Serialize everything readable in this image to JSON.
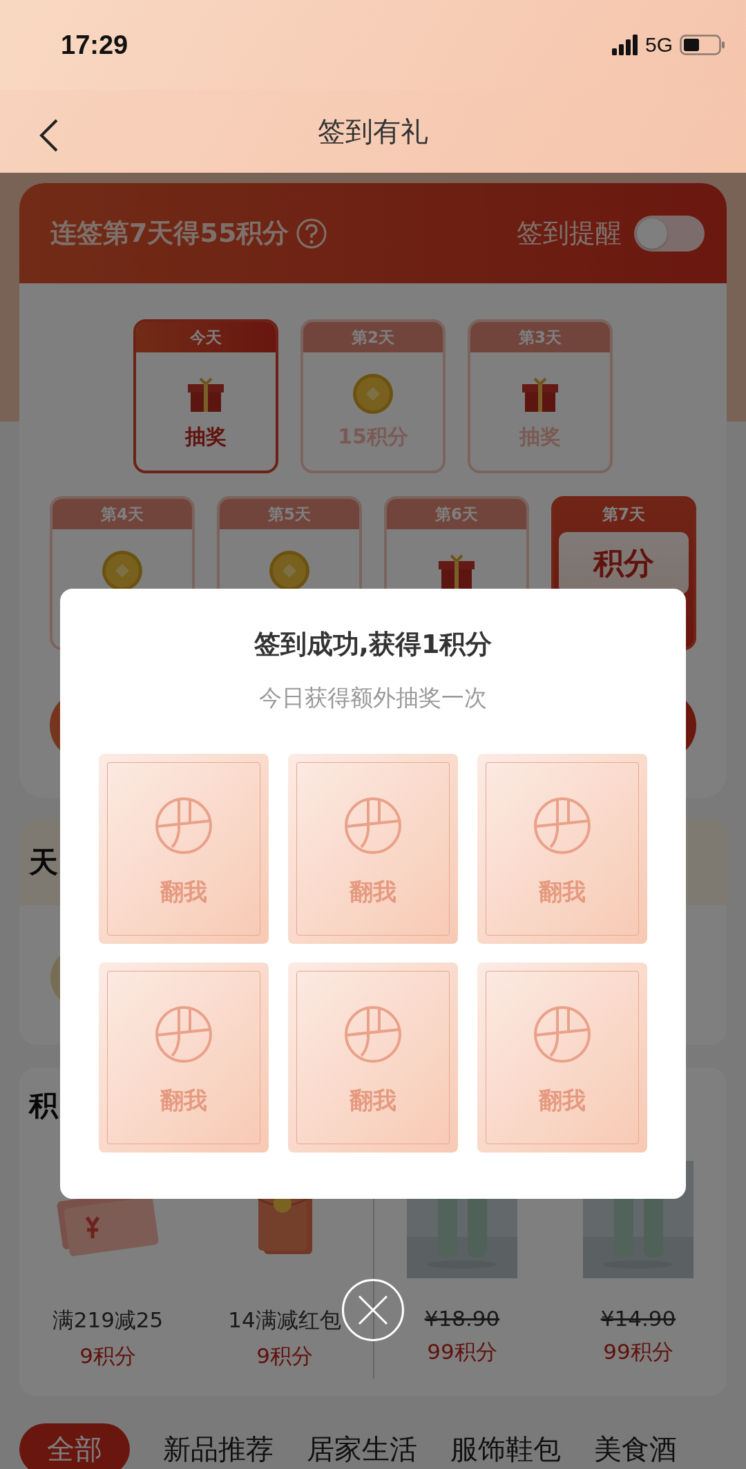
{
  "status_bar": {
    "time": "17:29",
    "network": "5G"
  },
  "nav": {
    "title": "签到有礼"
  },
  "streak": {
    "text": "连签第7天得55积分",
    "reminder_label": "签到提醒",
    "reminder_on": false
  },
  "days": [
    {
      "day": "今天",
      "kind": "gift",
      "reward": "抽奖",
      "selected": true
    },
    {
      "day": "第2天",
      "kind": "coin",
      "reward": "15积分",
      "selected": false
    },
    {
      "day": "第3天",
      "kind": "gift",
      "reward": "抽奖",
      "selected": false
    },
    {
      "day": "第4天",
      "kind": "coin",
      "selected": false
    },
    {
      "day": "第5天",
      "kind": "coin",
      "selected": false
    },
    {
      "day": "第6天",
      "kind": "gift",
      "selected": false
    },
    {
      "day": "第7天",
      "kind": "bonus",
      "reward": "积分",
      "selected": false
    }
  ],
  "sections": [
    {
      "title": "天"
    },
    {
      "title": "积"
    }
  ],
  "exchange_items": [
    {
      "kind": "coupon",
      "name": "满219减25",
      "points": "9积分"
    },
    {
      "kind": "envelope",
      "name": "14满减红包",
      "points": "9积分"
    },
    {
      "kind": "picture",
      "old_price": "¥18.90",
      "points": "99积分"
    },
    {
      "kind": "picture",
      "old_price": "¥14.90",
      "points": "99积分"
    }
  ],
  "categories": [
    {
      "label": "全部",
      "selected": true
    },
    {
      "label": "新品推荐",
      "selected": false
    },
    {
      "label": "居家生活",
      "selected": false
    },
    {
      "label": "服饰鞋包",
      "selected": false
    },
    {
      "label": "美食酒",
      "selected": false
    }
  ],
  "dialog": {
    "title": "签到成功,获得1积分",
    "subtitle": "今日获得额外抽奖一次",
    "cards": [
      {
        "label": "翻我"
      },
      {
        "label": "翻我"
      },
      {
        "label": "翻我"
      },
      {
        "label": "翻我"
      },
      {
        "label": "翻我"
      },
      {
        "label": "翻我"
      }
    ]
  }
}
